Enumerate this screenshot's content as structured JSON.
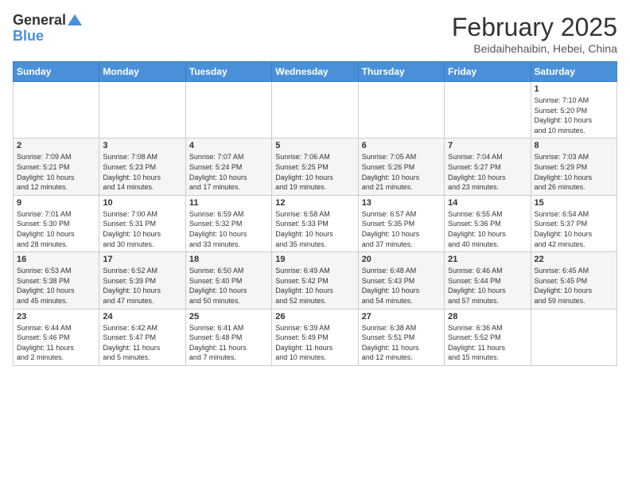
{
  "logo": {
    "general": "General",
    "blue": "Blue"
  },
  "header": {
    "month": "February 2025",
    "location": "Beidaihehaibin, Hebei, China"
  },
  "weekdays": [
    "Sunday",
    "Monday",
    "Tuesday",
    "Wednesday",
    "Thursday",
    "Friday",
    "Saturday"
  ],
  "weeks": [
    [
      {
        "day": "",
        "info": ""
      },
      {
        "day": "",
        "info": ""
      },
      {
        "day": "",
        "info": ""
      },
      {
        "day": "",
        "info": ""
      },
      {
        "day": "",
        "info": ""
      },
      {
        "day": "",
        "info": ""
      },
      {
        "day": "1",
        "info": "Sunrise: 7:10 AM\nSunset: 5:20 PM\nDaylight: 10 hours\nand 10 minutes."
      }
    ],
    [
      {
        "day": "2",
        "info": "Sunrise: 7:09 AM\nSunset: 5:21 PM\nDaylight: 10 hours\nand 12 minutes."
      },
      {
        "day": "3",
        "info": "Sunrise: 7:08 AM\nSunset: 5:23 PM\nDaylight: 10 hours\nand 14 minutes."
      },
      {
        "day": "4",
        "info": "Sunrise: 7:07 AM\nSunset: 5:24 PM\nDaylight: 10 hours\nand 17 minutes."
      },
      {
        "day": "5",
        "info": "Sunrise: 7:06 AM\nSunset: 5:25 PM\nDaylight: 10 hours\nand 19 minutes."
      },
      {
        "day": "6",
        "info": "Sunrise: 7:05 AM\nSunset: 5:26 PM\nDaylight: 10 hours\nand 21 minutes."
      },
      {
        "day": "7",
        "info": "Sunrise: 7:04 AM\nSunset: 5:27 PM\nDaylight: 10 hours\nand 23 minutes."
      },
      {
        "day": "8",
        "info": "Sunrise: 7:03 AM\nSunset: 5:29 PM\nDaylight: 10 hours\nand 26 minutes."
      }
    ],
    [
      {
        "day": "9",
        "info": "Sunrise: 7:01 AM\nSunset: 5:30 PM\nDaylight: 10 hours\nand 28 minutes."
      },
      {
        "day": "10",
        "info": "Sunrise: 7:00 AM\nSunset: 5:31 PM\nDaylight: 10 hours\nand 30 minutes."
      },
      {
        "day": "11",
        "info": "Sunrise: 6:59 AM\nSunset: 5:32 PM\nDaylight: 10 hours\nand 33 minutes."
      },
      {
        "day": "12",
        "info": "Sunrise: 6:58 AM\nSunset: 5:33 PM\nDaylight: 10 hours\nand 35 minutes."
      },
      {
        "day": "13",
        "info": "Sunrise: 6:57 AM\nSunset: 5:35 PM\nDaylight: 10 hours\nand 37 minutes."
      },
      {
        "day": "14",
        "info": "Sunrise: 6:55 AM\nSunset: 5:36 PM\nDaylight: 10 hours\nand 40 minutes."
      },
      {
        "day": "15",
        "info": "Sunrise: 6:54 AM\nSunset: 5:37 PM\nDaylight: 10 hours\nand 42 minutes."
      }
    ],
    [
      {
        "day": "16",
        "info": "Sunrise: 6:53 AM\nSunset: 5:38 PM\nDaylight: 10 hours\nand 45 minutes."
      },
      {
        "day": "17",
        "info": "Sunrise: 6:52 AM\nSunset: 5:39 PM\nDaylight: 10 hours\nand 47 minutes."
      },
      {
        "day": "18",
        "info": "Sunrise: 6:50 AM\nSunset: 5:40 PM\nDaylight: 10 hours\nand 50 minutes."
      },
      {
        "day": "19",
        "info": "Sunrise: 6:49 AM\nSunset: 5:42 PM\nDaylight: 10 hours\nand 52 minutes."
      },
      {
        "day": "20",
        "info": "Sunrise: 6:48 AM\nSunset: 5:43 PM\nDaylight: 10 hours\nand 54 minutes."
      },
      {
        "day": "21",
        "info": "Sunrise: 6:46 AM\nSunset: 5:44 PM\nDaylight: 10 hours\nand 57 minutes."
      },
      {
        "day": "22",
        "info": "Sunrise: 6:45 AM\nSunset: 5:45 PM\nDaylight: 10 hours\nand 59 minutes."
      }
    ],
    [
      {
        "day": "23",
        "info": "Sunrise: 6:44 AM\nSunset: 5:46 PM\nDaylight: 11 hours\nand 2 minutes."
      },
      {
        "day": "24",
        "info": "Sunrise: 6:42 AM\nSunset: 5:47 PM\nDaylight: 11 hours\nand 5 minutes."
      },
      {
        "day": "25",
        "info": "Sunrise: 6:41 AM\nSunset: 5:48 PM\nDaylight: 11 hours\nand 7 minutes."
      },
      {
        "day": "26",
        "info": "Sunrise: 6:39 AM\nSunset: 5:49 PM\nDaylight: 11 hours\nand 10 minutes."
      },
      {
        "day": "27",
        "info": "Sunrise: 6:38 AM\nSunset: 5:51 PM\nDaylight: 11 hours\nand 12 minutes."
      },
      {
        "day": "28",
        "info": "Sunrise: 6:36 AM\nSunset: 5:52 PM\nDaylight: 11 hours\nand 15 minutes."
      },
      {
        "day": "",
        "info": ""
      }
    ]
  ]
}
